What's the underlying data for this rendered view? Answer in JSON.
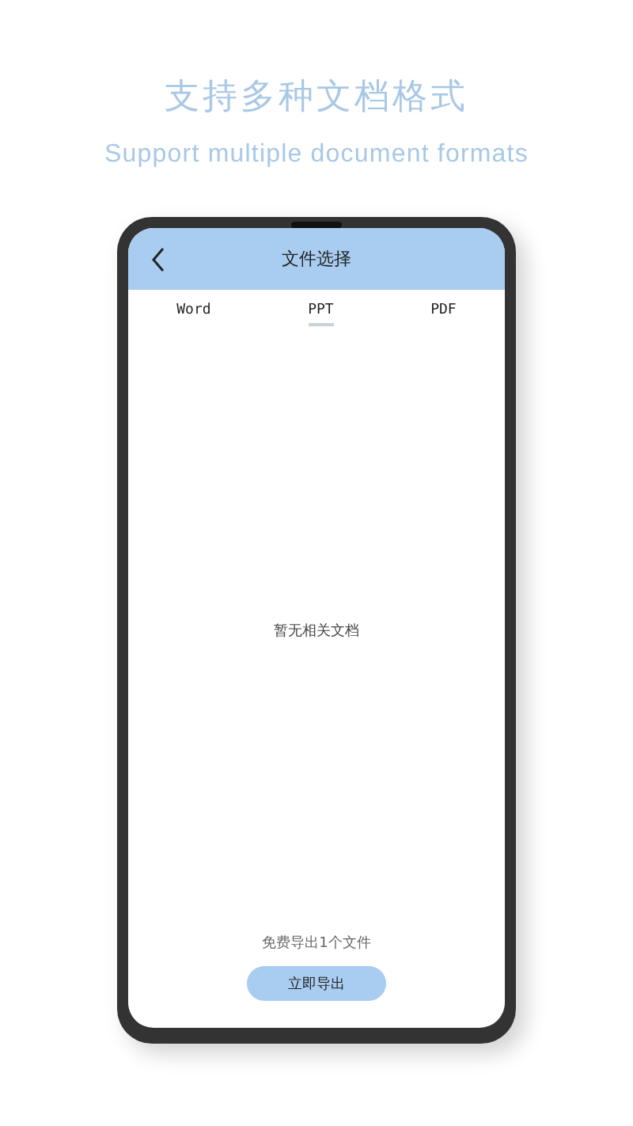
{
  "headline": "支持多种文档格式",
  "subtitle": "Support multiple document formats",
  "screen": {
    "title": "文件选择",
    "tabs": [
      {
        "label": "Word",
        "selected": false
      },
      {
        "label": "PPT",
        "selected": true
      },
      {
        "label": "PDF",
        "selected": false
      }
    ],
    "empty_message": "暂无相关文档",
    "quota_note": "免费导出1个文件",
    "export_button": "立即导出"
  }
}
